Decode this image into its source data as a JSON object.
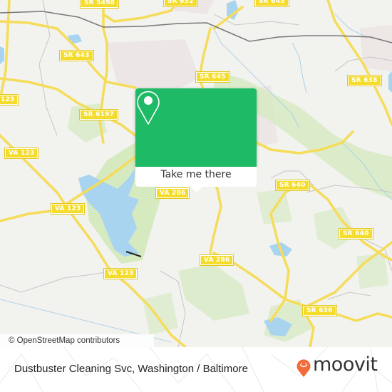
{
  "map": {
    "colors": {
      "background": "#f2f2ef",
      "road": "#f5dc5a",
      "water": "#a8d4f0",
      "park": "#d6eac0",
      "railway": "#777777",
      "shield": "#f5dc2b",
      "popup_accent": "#1fba66",
      "brand": "#f26b3a"
    },
    "road_labels": [
      {
        "id": "sr5498",
        "text": "SR 5498"
      },
      {
        "id": "sr652a",
        "text": "SR 652"
      },
      {
        "id": "sr652b",
        "text": "SR 645"
      },
      {
        "id": "sr643",
        "text": "SR 643"
      },
      {
        "id": "sr645",
        "text": "SR 645"
      },
      {
        "id": "sr638",
        "text": "SR 638"
      },
      {
        "id": "sr6197",
        "text": "SR 6197"
      },
      {
        "id": "va123a",
        "text": "123"
      },
      {
        "id": "va123b",
        "text": "VA 123"
      },
      {
        "id": "va123c",
        "text": "VA 123"
      },
      {
        "id": "va123d",
        "text": "VA 123"
      },
      {
        "id": "va286a",
        "text": "VA 286"
      },
      {
        "id": "va286b",
        "text": "VA 286"
      },
      {
        "id": "sr640a",
        "text": "SR 640"
      },
      {
        "id": "sr640b",
        "text": "SR 640"
      },
      {
        "id": "sr636",
        "text": "SR 636"
      }
    ],
    "attribution": "© OpenStreetMap contributors"
  },
  "popup": {
    "icon": "map-pin-icon",
    "button_label": "Take me there"
  },
  "footer": {
    "place_name": "Dustbuster Cleaning Svc, Washington / Baltimore",
    "brand_name": "moovit",
    "brand_icon": "moovit-smiley-pin-icon"
  }
}
